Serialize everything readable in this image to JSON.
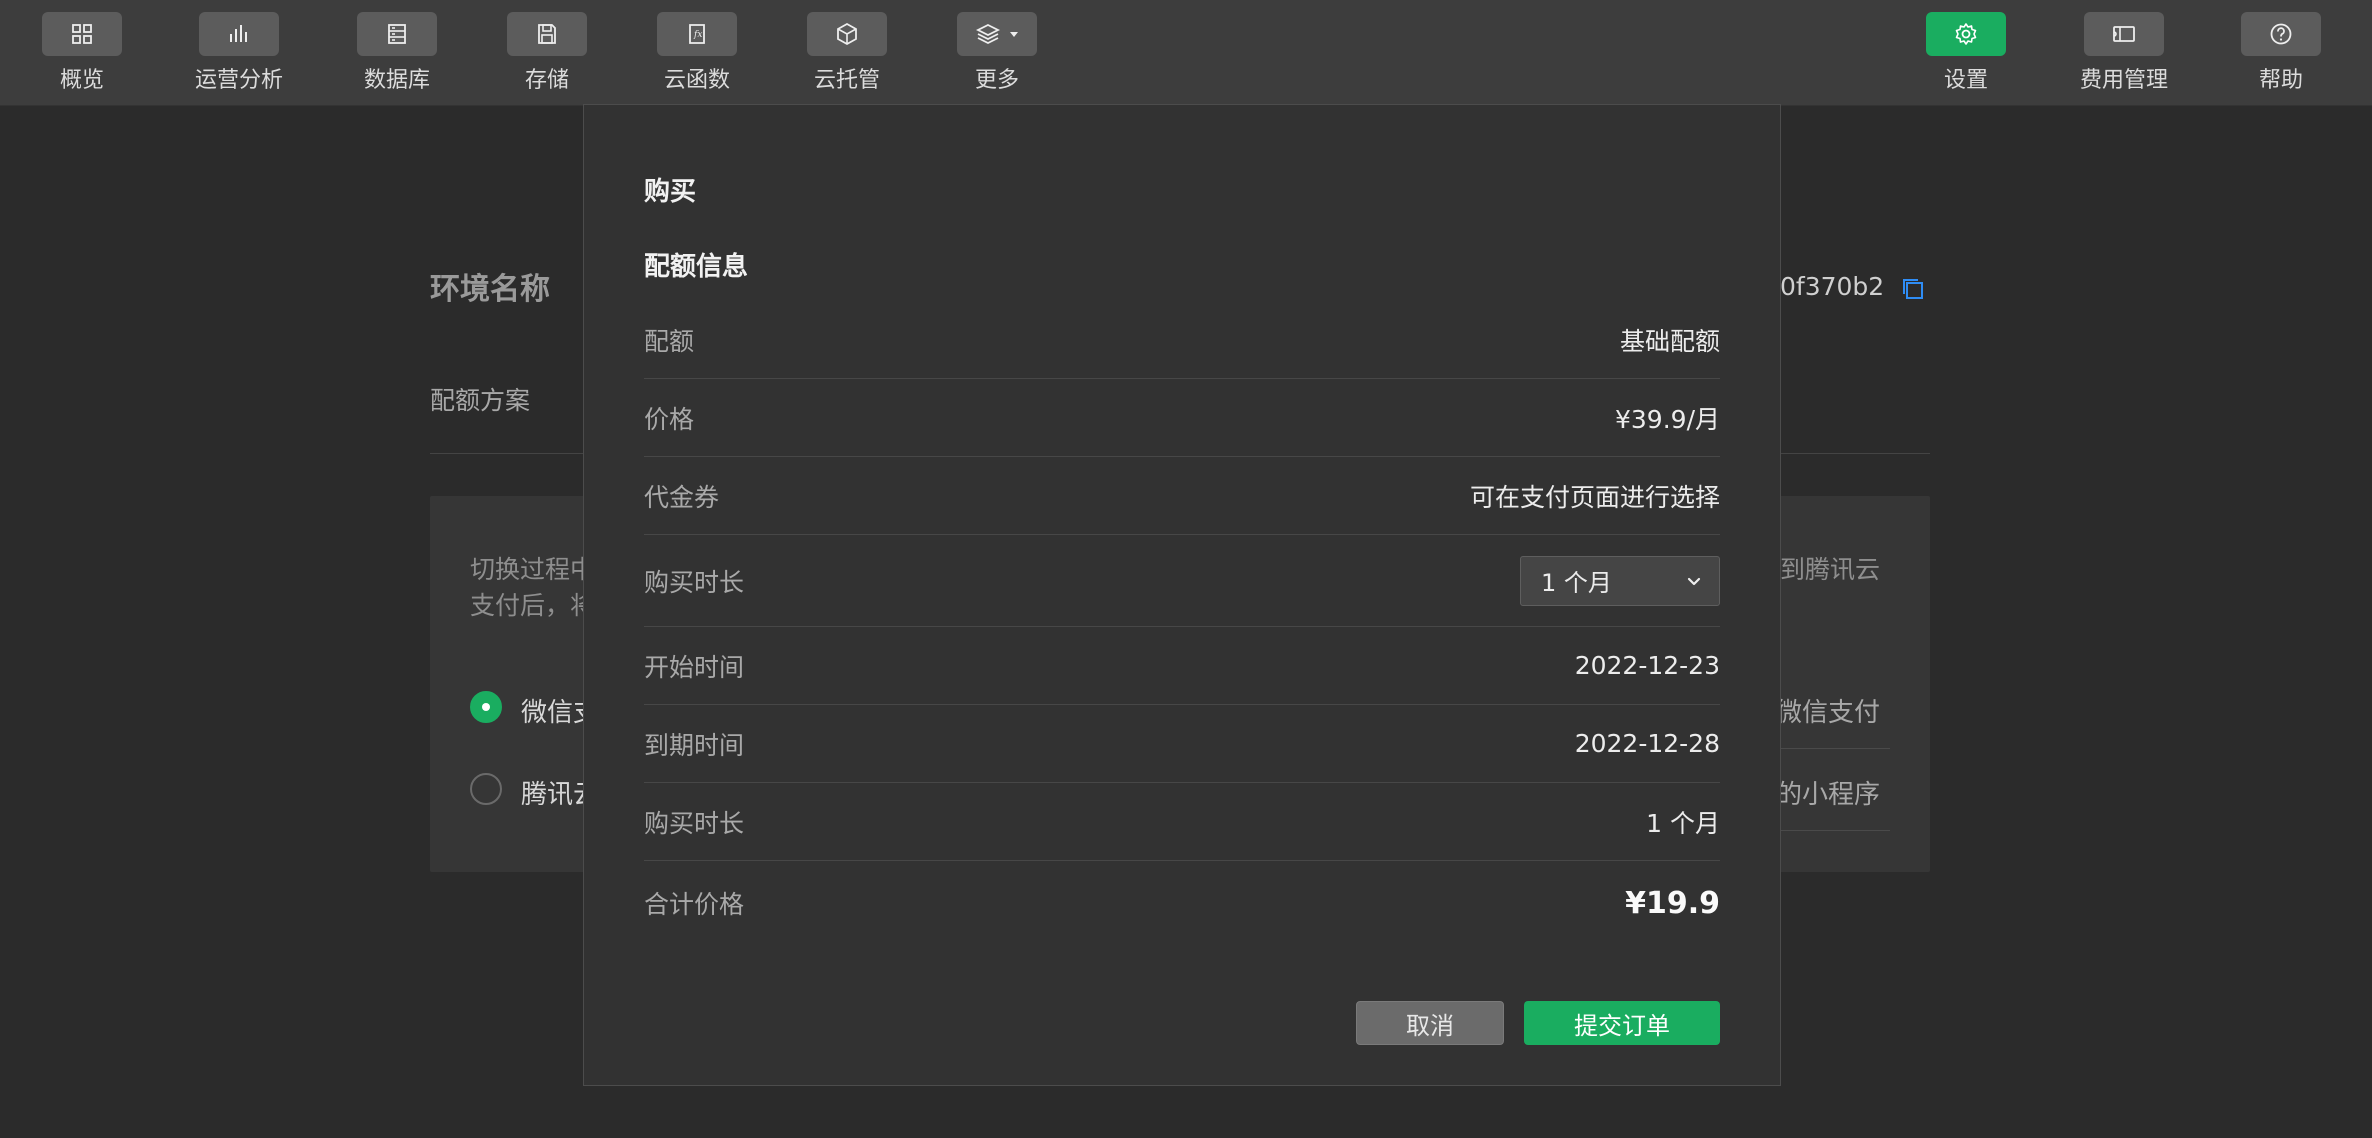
{
  "toolbar": {
    "left_items": [
      {
        "label": "概览",
        "icon": "grid-icon"
      },
      {
        "label": "运营分析",
        "icon": "bar-chart-icon"
      },
      {
        "label": "数据库",
        "icon": "database-icon"
      },
      {
        "label": "存储",
        "icon": "save-icon"
      },
      {
        "label": "云函数",
        "icon": "function-icon"
      },
      {
        "label": "云托管",
        "icon": "cube-icon"
      },
      {
        "label": "更多",
        "icon": "layers-icon"
      }
    ],
    "right_items": [
      {
        "label": "设置",
        "icon": "gear-icon"
      },
      {
        "label": "费用管理",
        "icon": "ticket-icon"
      },
      {
        "label": "帮助",
        "icon": "help-icon"
      }
    ]
  },
  "background": {
    "env_title": "环境名称",
    "env_id_fragment": "0f370b2",
    "plan_label": "配额方案",
    "desc_line1": "切换过程中",
    "desc_line2": "支付后，将",
    "desc_right": "到腾讯云",
    "option1_left": "微信支",
    "option1_right": "微信支付",
    "option2_left": "腾讯云",
    "option2_right": "的小程序"
  },
  "modal": {
    "title": "购买",
    "section_title": "配额信息",
    "rows": [
      {
        "label": "配额",
        "value": "基础配额"
      },
      {
        "label": "价格",
        "value": "¥39.9/月"
      },
      {
        "label": "代金券",
        "value": "可在支付页面进行选择"
      },
      {
        "label": "购买时长",
        "select_value": "1 个月"
      },
      {
        "label": "开始时间",
        "value": "2022-12-23"
      },
      {
        "label": "到期时间",
        "value": "2022-12-28"
      },
      {
        "label": "购买时长",
        "value": "1 个月"
      },
      {
        "label": "合计价格",
        "value": "¥19.9"
      }
    ],
    "cancel_label": "取消",
    "submit_label": "提交订单"
  },
  "colors": {
    "accent": "#1aad60",
    "link_blue": "#2f8df5",
    "background": "#2b2b2b",
    "toolbar": "#3d3d3d",
    "modal": "#323232"
  }
}
